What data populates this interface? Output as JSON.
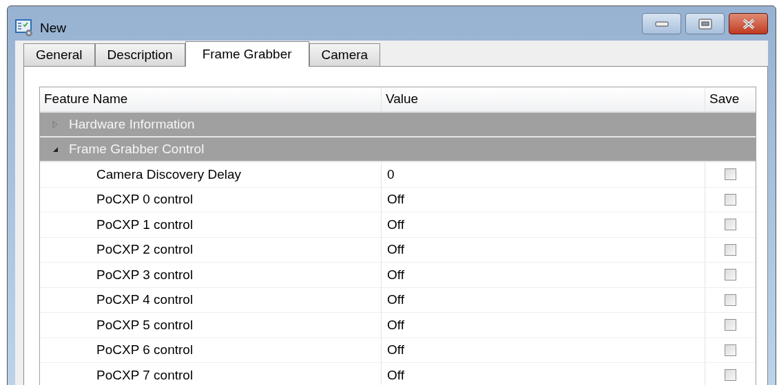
{
  "window": {
    "title": "New"
  },
  "tabs": [
    {
      "label": "General",
      "selected": false
    },
    {
      "label": "Description",
      "selected": false
    },
    {
      "label": "Frame Grabber",
      "selected": true
    },
    {
      "label": "Camera",
      "selected": false
    }
  ],
  "table": {
    "columns": [
      "Feature Name",
      "Value",
      "Save"
    ],
    "groups": [
      {
        "label": "Hardware Information",
        "expanded": false
      },
      {
        "label": "Frame Grabber Control",
        "expanded": true,
        "children": [
          {
            "name": "Camera Discovery Delay",
            "value": "0",
            "checked": false
          },
          {
            "name": "PoCXP 0 control",
            "value": "Off",
            "checked": false
          },
          {
            "name": "PoCXP 1 control",
            "value": "Off",
            "checked": false
          },
          {
            "name": "PoCXP 2 control",
            "value": "Off",
            "checked": false
          },
          {
            "name": "PoCXP 3 control",
            "value": "Off",
            "checked": false
          },
          {
            "name": "PoCXP 4 control",
            "value": "Off",
            "checked": false
          },
          {
            "name": "PoCXP 5 control",
            "value": "Off",
            "checked": false
          },
          {
            "name": "PoCXP 6 control",
            "value": "Off",
            "checked": false
          },
          {
            "name": "PoCXP 7 control",
            "value": "Off",
            "checked": false
          }
        ]
      }
    ]
  }
}
